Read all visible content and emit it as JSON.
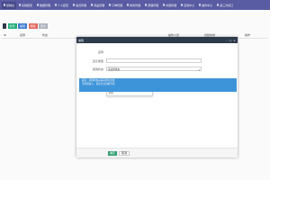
{
  "nav": {
    "items": [
      "控制台",
      "系统配置",
      "数据管理",
      "个人配置",
      "会员管理",
      "商品管理",
      "订单管理",
      "财务管理",
      "营销管理",
      "内容管理",
      "应用中心",
      "插件中心",
      "第三方接口"
    ]
  },
  "toolbar": {
    "add": "新增",
    "edit": "编辑",
    "del": "删除",
    "more": "更多"
  },
  "table": {
    "headers": [
      "ID",
      "名称",
      "状态",
      "操作人员",
      "创建时间",
      "操作"
    ]
  },
  "modal": {
    "title": "编辑",
    "fields": {
      "name_label": "名称",
      "name_value": "",
      "type_label": "显示类型",
      "type_value": "",
      "perm_label": "使用状态",
      "perm_value": "请选择状态"
    },
    "dropdown": [
      "请选择状态",
      "启用(正常)",
      "禁用"
    ],
    "confirm": "确定",
    "cancel": "取消"
  },
  "notice": {
    "lines": [
      "提示：选择状态后保存即可生效",
      "不同状态下，显示方式可能不同"
    ]
  }
}
